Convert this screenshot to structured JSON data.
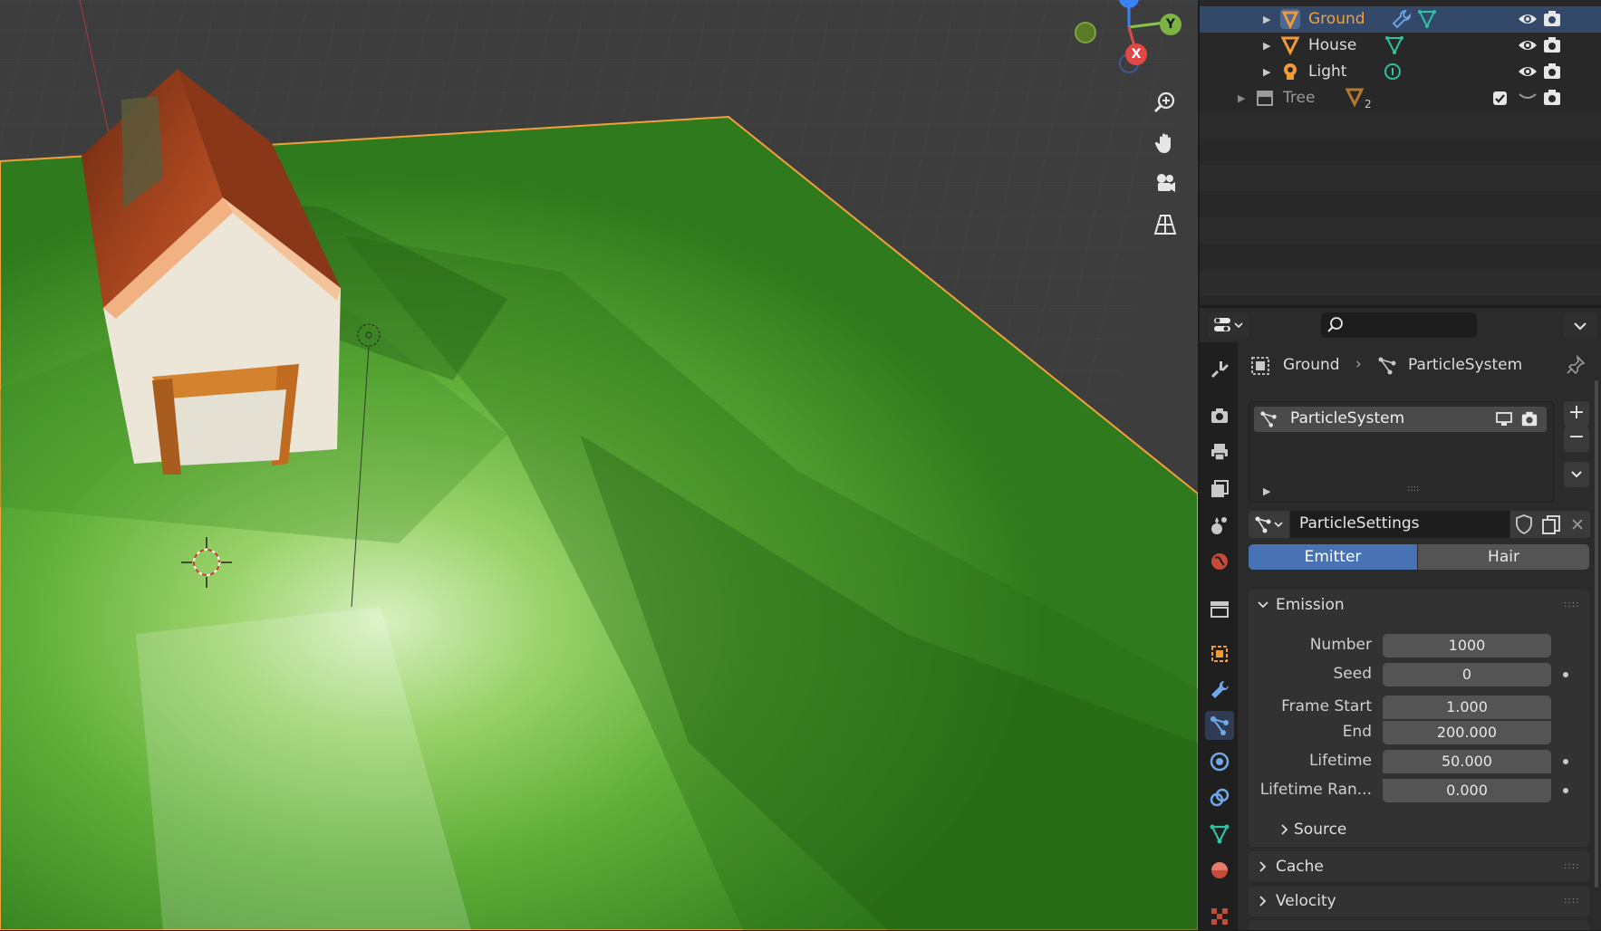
{
  "outliner": {
    "rows": [
      {
        "label": "Ground",
        "selected": true
      },
      {
        "label": "House",
        "selected": false
      },
      {
        "label": "Light",
        "selected": false
      },
      {
        "label": "Tree",
        "selected": false,
        "badge": "2"
      }
    ]
  },
  "properties": {
    "search_placeholder": "",
    "breadcrumb": {
      "object": "Ground",
      "system": "ParticleSystem"
    },
    "particle_list": {
      "item": "ParticleSystem"
    },
    "settings": {
      "name": "ParticleSettings"
    },
    "type_tabs": {
      "emitter": "Emitter",
      "hair": "Hair",
      "active": "emitter"
    },
    "emission": {
      "title": "Emission",
      "number_label": "Number",
      "number": "1000",
      "seed_label": "Seed",
      "seed": "0",
      "frame_start_label": "Frame Start",
      "frame_start": "1.000",
      "end_label": "End",
      "end": "200.000",
      "lifetime_label": "Lifetime",
      "lifetime": "50.000",
      "lifetime_random_label": "Lifetime Ran...",
      "lifetime_random": "0.000",
      "source_label": "Source"
    },
    "panels": {
      "cache": "Cache",
      "velocity": "Velocity"
    }
  },
  "gizmo": {
    "x_label": "X",
    "y_label": "Y"
  },
  "colors": {
    "accent": "#4772b3",
    "selection_outline": "#f2a13a",
    "ground": "#4aa52e",
    "roof": "#a8461f",
    "wall": "#ebe6d8"
  }
}
